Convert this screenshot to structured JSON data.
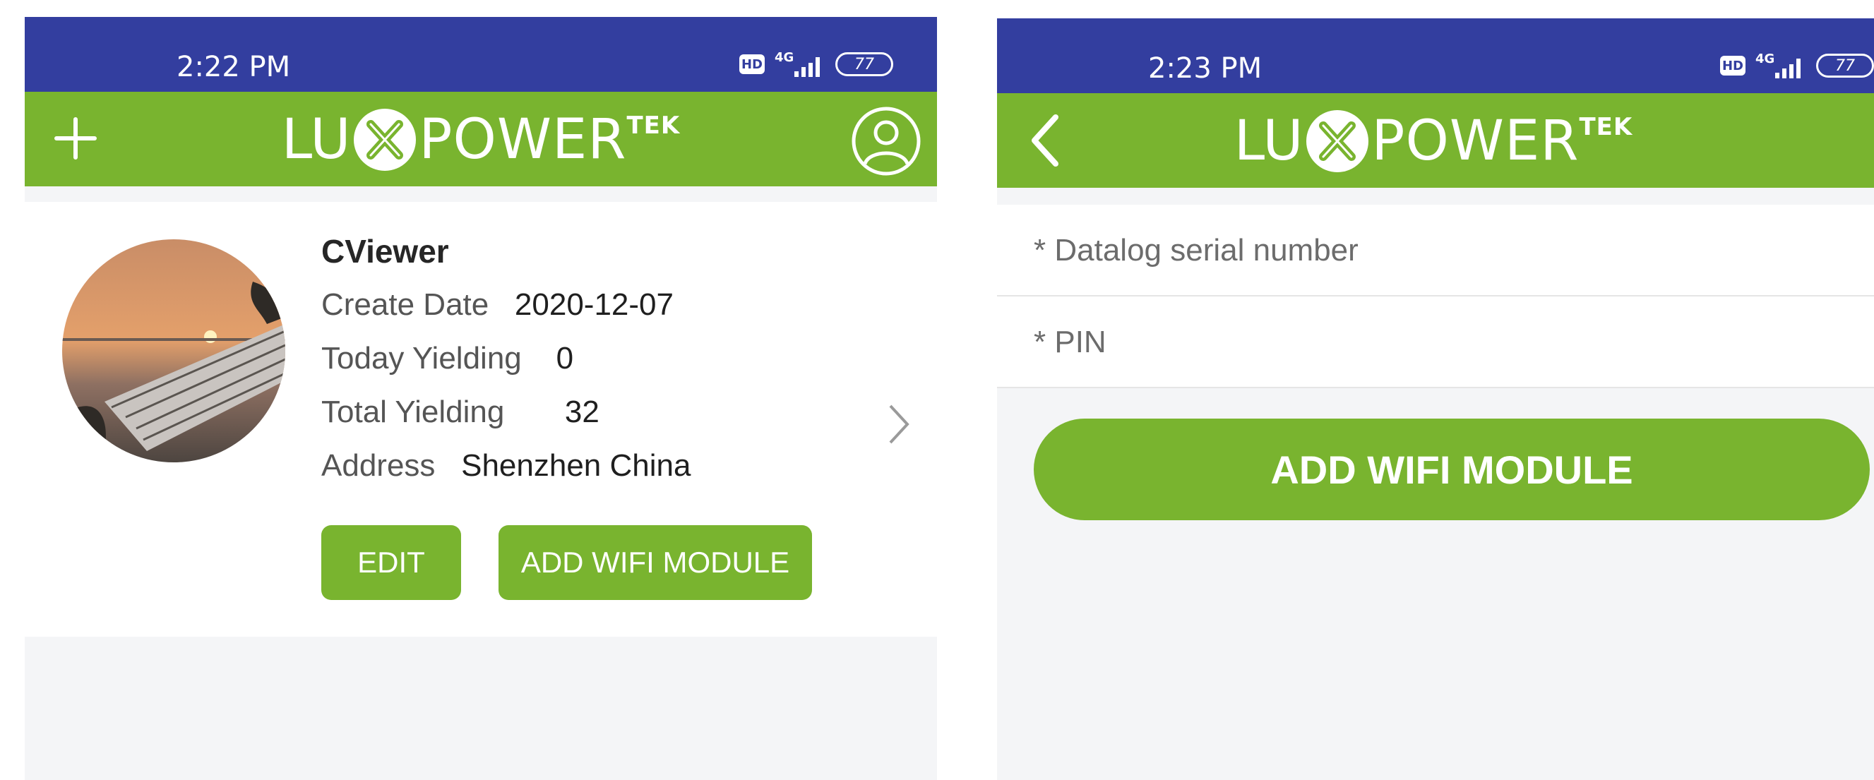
{
  "left_screen": {
    "status_bar": {
      "time": "2:22 PM",
      "hd": "HD",
      "network": "4G",
      "battery": "77"
    },
    "app_bar": {
      "logo": {
        "text_left": "LU",
        "text_right": "POWER",
        "superscript": "TEK"
      },
      "left_icon": "plus-icon",
      "right_icon": "user-circle-icon"
    },
    "station": {
      "name": "CViewer",
      "create_date_label": "Create Date",
      "create_date_value": "2020-12-07",
      "today_yield_label": "Today Yielding",
      "today_yield_value": "0",
      "total_yield_label": "Total Yielding",
      "total_yield_value": "32",
      "address_label": "Address",
      "address_value": "Shenzhen China",
      "edit_label": "EDIT",
      "add_wifi_label": "ADD WIFI MODULE",
      "avatar": "solar-panel-sunset-photo",
      "chevron_icon": "chevron-right-icon"
    }
  },
  "right_screen": {
    "status_bar": {
      "time": "2:23 PM",
      "hd": "HD",
      "network": "4G",
      "battery": "77"
    },
    "app_bar": {
      "logo": {
        "text_left": "LU",
        "text_right": "POWER",
        "superscript": "TEK"
      },
      "left_icon": "back-arrow-icon"
    },
    "form": {
      "serial_placeholder": "* Datalog serial number",
      "pin_placeholder": "* PIN",
      "submit_label": "ADD WIFI MODULE"
    }
  },
  "colors": {
    "status_bar": "#333e9f",
    "brand_green": "#79b42f",
    "background": "#f4f5f7"
  }
}
